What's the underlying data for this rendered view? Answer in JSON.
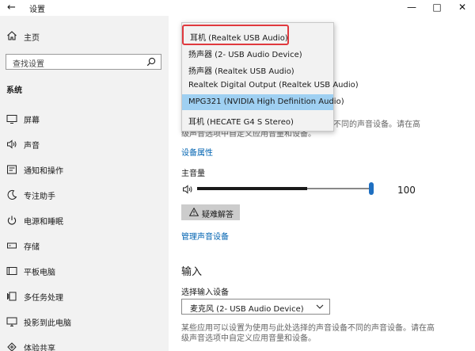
{
  "window": {
    "title": "设置",
    "back_glyph": "←",
    "minimize_glyph": "—",
    "maximize_glyph": "□",
    "close_glyph": "✕"
  },
  "sidebar": {
    "home_label": "主页",
    "search_placeholder": "查找设置",
    "section_title": "系统",
    "items": [
      {
        "label": "屏幕",
        "icon": "display-icon"
      },
      {
        "label": "声音",
        "icon": "speaker-icon"
      },
      {
        "label": "通知和操作",
        "icon": "notification-icon"
      },
      {
        "label": "专注助手",
        "icon": "moon-icon"
      },
      {
        "label": "电源和睡眠",
        "icon": "power-icon"
      },
      {
        "label": "存储",
        "icon": "storage-icon"
      },
      {
        "label": "平板电脑",
        "icon": "tablet-icon"
      },
      {
        "label": "多任务处理",
        "icon": "multitask-icon"
      },
      {
        "label": "投影到此电脑",
        "icon": "project-icon"
      },
      {
        "label": "体验共享",
        "icon": "share-icon"
      }
    ]
  },
  "output": {
    "desc_line1": "不同的声音设备。请在高",
    "desc_line2": "级声音选项中自定义应用音量和设备。",
    "device_properties": "设备属性",
    "master_volume_label": "主音量",
    "volume": 100,
    "volume_display": "100",
    "troubleshoot_label": "疑难解答",
    "manage_devices": "管理声音设备"
  },
  "input": {
    "heading": "输入",
    "select_label": "选择输入设备",
    "selected_device": "麦克风 (2- USB Audio Device)",
    "desc_line1": "某些应用可以设置为使用与此处选择的声音设备不同的声音设备。请在高",
    "desc_line2": "级声音选项中自定义应用音量和设备。"
  },
  "dropdown": {
    "options": [
      "耳机 (Realtek USB Audio)",
      "扬声器 (2- USB Audio Device)",
      "扬声器 (Realtek USB Audio)",
      "Realtek Digital Output (Realtek USB Audio)",
      "MPG321 (NVIDIA High Definition Audio)",
      "耳机 (HECATE G4 S Stereo)"
    ],
    "highlighted_index": 4,
    "outlined_index": 0
  },
  "colors": {
    "accent": "#1e6fc1",
    "link": "#0063b1",
    "highlight": "#9fd0f2",
    "outline": "#e0393e"
  }
}
